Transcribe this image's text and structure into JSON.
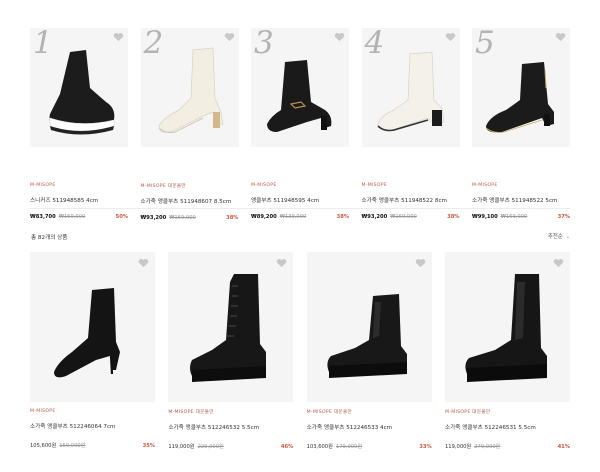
{
  "ranking": [
    {
      "rank": "1",
      "brand": "M-MISOPE",
      "name": "스니커즈 511948585 4cm",
      "price": "₩83,700",
      "original": "₩169,000",
      "discount": "50%",
      "image": "black-sock-sneaker"
    },
    {
      "rank": "2",
      "brand": "M-MISOPE 대문몰만",
      "name": "소가죽 앵클부츠 511948607 8.5cm",
      "price": "₩93,200",
      "original": "₩169,000",
      "discount": "38%",
      "image": "ivory-ankle-boot"
    },
    {
      "rank": "3",
      "brand": "M-MISOPE",
      "name": "앵클부츠 511948595 4cm",
      "price": "₩89,200",
      "original": "₩139,000",
      "discount": "38%",
      "image": "black-buckle-boot"
    },
    {
      "rank": "4",
      "brand": "M-MISOPE",
      "name": "소가죽 앵클부츠 511948522 8cm",
      "price": "₩93,200",
      "original": "₩169,000",
      "discount": "38%",
      "image": "white-block-heel-boot"
    },
    {
      "rank": "5",
      "brand": "M-MISOPE",
      "name": "소가죽 앵클부츠 511948522 5cm",
      "price": "₩99,100",
      "original": "₩169,000",
      "discount": "37%",
      "image": "black-zip-boot"
    }
  ],
  "list_header": {
    "total": "총 82개의 상품",
    "sort": "추천순"
  },
  "products": [
    {
      "brand": "M-MISOPE",
      "name": "소가죽 앵클부츠 512246064 7cm",
      "price": "105,600원",
      "original": "159,000원",
      "discount": "35%",
      "image": "black-suede-stiletto-boot"
    },
    {
      "brand": "M-MISOPE 대문몰만",
      "name": "소가죽 앵클부츠 512246532 5.5cm",
      "price": "119,000원",
      "original": "229,000원",
      "discount": "46%",
      "image": "black-lace-up-combat-boot"
    },
    {
      "brand": "M-MISOPE 대문몰만",
      "name": "소가죽 앵클부츠 512246533 4cm",
      "price": "103,600원",
      "original": "179,000원",
      "discount": "33%",
      "image": "black-chelsea-boot-short"
    },
    {
      "brand": "M-MISOPE 대문몰만",
      "name": "소가죽 앵클부츠 512246531 5.5cm",
      "price": "119,000원",
      "original": "279,000원",
      "discount": "41%",
      "image": "black-chelsea-boot-tall"
    }
  ],
  "colors": {
    "accent": "#b25c4c",
    "discount": "#d0553f",
    "card_bg": "#f5f5f5"
  }
}
